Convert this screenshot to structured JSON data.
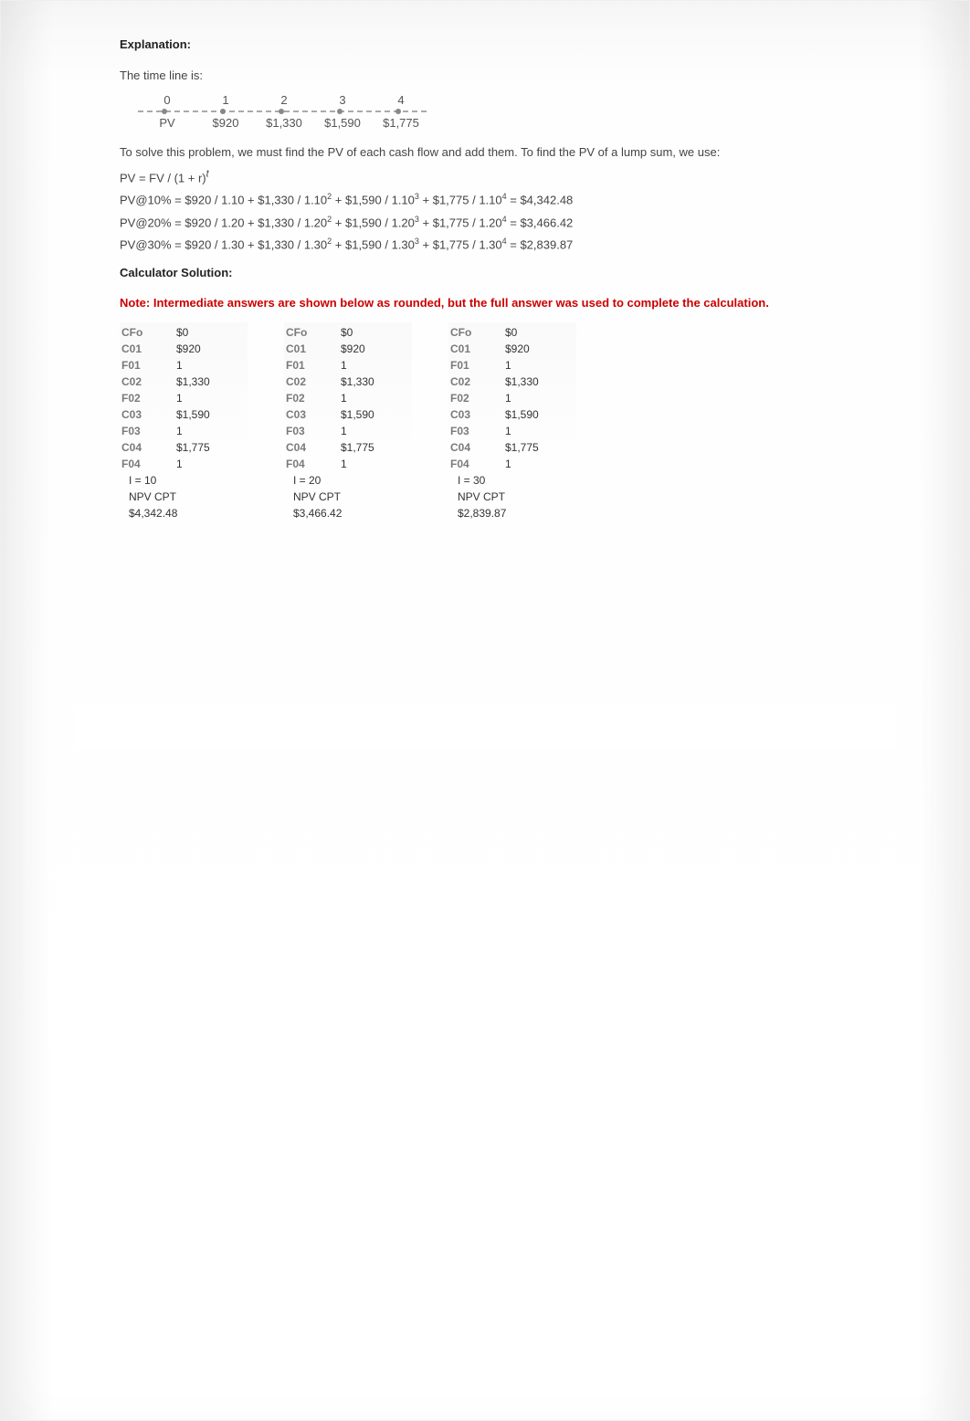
{
  "headings": {
    "explanation": "Explanation:",
    "calc_solution": "Calculator Solution:"
  },
  "intro": "The time line is:",
  "timeline": {
    "periods": [
      "0",
      "1",
      "2",
      "3",
      "4"
    ],
    "values": [
      "PV",
      "$920",
      "$1,330",
      "$1,590",
      "$1,775"
    ]
  },
  "para_solve": "To solve this problem, we must find the PV of each cash flow and add them. To find the PV of a lump sum, we use:",
  "formula_pv": "PV = FV / (1 + r)",
  "formula_pv_sup": "t",
  "eq_lines": [
    {
      "lhs": "PV@10% = $920 / 1.10 + $1,330 / 1.10",
      "s2": "2",
      "m1": " + $1,590 / 1.10",
      "s3": "3",
      "m2": " + $1,775 / 1.10",
      "s4": "4",
      "rhs": "  = $4,342.48"
    },
    {
      "lhs": "PV@20% = $920 / 1.20 + $1,330 / 1.20",
      "s2": "2",
      "m1": " + $1,590 / 1.20",
      "s3": "3",
      "m2": " + $1,775 / 1.20",
      "s4": "4",
      "rhs": "  = $3,466.42"
    },
    {
      "lhs": "PV@30% = $920 / 1.30 + $1,330 / 1.30",
      "s2": "2",
      "m1": " + $1,590 / 1.30",
      "s3": "3",
      "m2": " + $1,775 / 1.30",
      "s4": "4",
      "rhs": "  = $2,839.87"
    }
  ],
  "note": "Note: Intermediate answers are shown below as rounded, but the full answer was used to complete the calculation.",
  "calc_labels": {
    "CFo": "CFo",
    "C01": "C01",
    "F01": "F01",
    "C02": "C02",
    "F02": "F02",
    "C03": "C03",
    "F03": "F03",
    "C04": "C04",
    "F04": "F04",
    "NPV": "NPV CPT"
  },
  "calc_cols": [
    {
      "CFo": "$0",
      "C01": "$920",
      "F01": "1",
      "C02": "$1,330",
      "F02": "1",
      "C03": "$1,590",
      "F03": "1",
      "C04": "$1,775",
      "F04": "1",
      "I": "I = 10",
      "NPV": "$4,342.48"
    },
    {
      "CFo": "$0",
      "C01": "$920",
      "F01": "1",
      "C02": "$1,330",
      "F02": "1",
      "C03": "$1,590",
      "F03": "1",
      "C04": "$1,775",
      "F04": "1",
      "I": "I = 20",
      "NPV": "$3,466.42"
    },
    {
      "CFo": "$0",
      "C01": "$920",
      "F01": "1",
      "C02": "$1,330",
      "F02": "1",
      "C03": "$1,590",
      "F03": "1",
      "C04": "$1,775",
      "F04": "1",
      "I": "I = 30",
      "NPV": "$2,839.87"
    }
  ],
  "chart_data": {
    "type": "table",
    "title": "Present Value of Cash Flows",
    "cash_flows": {
      "years": [
        0,
        1,
        2,
        3,
        4
      ],
      "values": [
        null,
        920,
        1330,
        1590,
        1775
      ]
    },
    "results": [
      {
        "rate_pct": 10,
        "pv": 4342.48
      },
      {
        "rate_pct": 20,
        "pv": 3466.42
      },
      {
        "rate_pct": 30,
        "pv": 2839.87
      }
    ]
  }
}
